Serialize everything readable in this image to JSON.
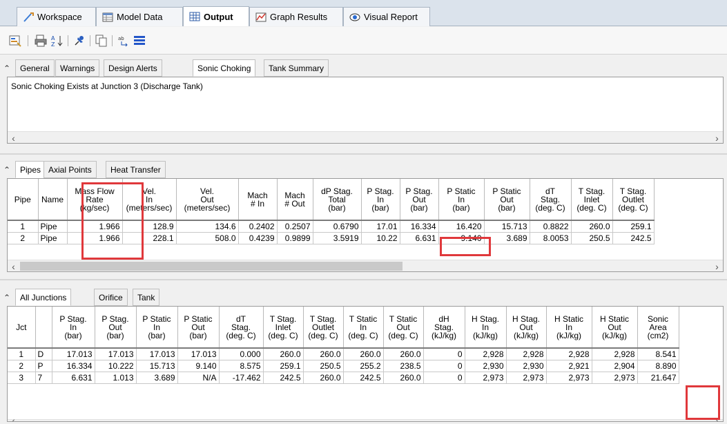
{
  "main_tabs": [
    {
      "label": "Workspace"
    },
    {
      "label": "Model Data"
    },
    {
      "label": "Output"
    },
    {
      "label": "Graph Results"
    },
    {
      "label": "Visual Report"
    }
  ],
  "general_tabs": [
    "General",
    "Warnings",
    "Design Alerts",
    "Sonic Choking",
    "Tank Summary"
  ],
  "message": "Sonic Choking Exists at Junction 3 (Discharge Tank)",
  "pipe_tabs": [
    "Pipes",
    "Axial Points",
    "Heat Transfer"
  ],
  "pipes": {
    "headers": [
      "Pipe",
      "Name",
      "Mass Flow\nRate\n(kg/sec)",
      "Vel.\nIn\n(meters/sec)",
      "Vel.\nOut\n(meters/sec)",
      "Mach\n# In",
      "Mach\n# Out",
      "dP Stag.\nTotal\n(bar)",
      "P Stag.\nIn\n(bar)",
      "P Stag.\nOut\n(bar)",
      "P Static\nIn\n(bar)",
      "P Static\nOut\n(bar)",
      "dT\nStag.\n(deg. C)",
      "T Stag.\nInlet\n(deg. C)",
      "T Stag.\nOutlet\n(deg. C)"
    ],
    "rows": [
      [
        "1",
        "Pipe",
        "1.966",
        "128.9",
        "134.6",
        "0.2402",
        "0.2507",
        "0.6790",
        "17.01",
        "16.334",
        "16.420",
        "15.713",
        "0.8822",
        "260.0",
        "259.1"
      ],
      [
        "2",
        "Pipe",
        "1.966",
        "228.1",
        "508.0",
        "0.4239",
        "0.9899",
        "3.5919",
        "10.22",
        "6.631",
        "9.140",
        "3.689",
        "8.0053",
        "250.5",
        "242.5"
      ]
    ]
  },
  "junction_tabs": [
    "All Junctions",
    "Orifice",
    "Tank"
  ],
  "junctions": {
    "headers": [
      "Jct",
      "",
      "P Stag.\nIn\n(bar)",
      "P Stag.\nOut\n(bar)",
      "P Static\nIn\n(bar)",
      "P Static\nOut\n(bar)",
      "dT\nStag.\n(deg. C)",
      "T Stag.\nInlet\n(deg. C)",
      "T Stag.\nOutlet\n(deg. C)",
      "T Static\nIn\n(deg. C)",
      "T Static\nOut\n(deg. C)",
      "dH\nStag.\n(kJ/kg)",
      "H Stag.\nIn\n(kJ/kg)",
      "H Stag.\nOut\n(kJ/kg)",
      "H Static\nIn\n(kJ/kg)",
      "H Static\nOut\n(kJ/kg)",
      "Sonic\nArea\n(cm2)"
    ],
    "rows": [
      [
        "1",
        "D",
        "17.013",
        "17.013",
        "17.013",
        "17.013",
        "0.000",
        "260.0",
        "260.0",
        "260.0",
        "260.0",
        "0",
        "2,928",
        "2,928",
        "2,928",
        "2,928",
        "8.541"
      ],
      [
        "2",
        "P",
        "16.334",
        "10.222",
        "15.713",
        "9.140",
        "8.575",
        "259.1",
        "250.5",
        "255.2",
        "238.5",
        "0",
        "2,930",
        "2,930",
        "2,921",
        "2,904",
        "8.890"
      ],
      [
        "3",
        "7",
        "6.631",
        "1.013",
        "3.689",
        "N/A",
        "-17.462",
        "242.5",
        "260.0",
        "242.5",
        "260.0",
        "0",
        "2,973",
        "2,973",
        "2,973",
        "2,973",
        "21.647"
      ]
    ]
  },
  "colors": {
    "highlight": "#e0383b",
    "tab_bar": "#dbe3ec"
  }
}
